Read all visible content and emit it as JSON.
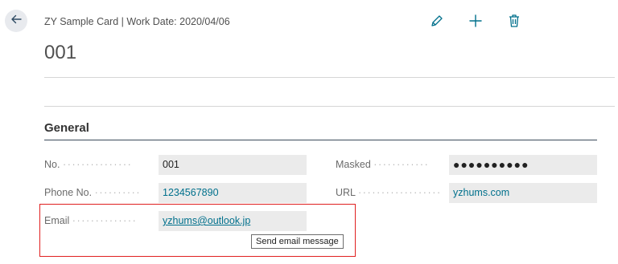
{
  "header": {
    "breadcrumb": "ZY Sample Card | Work Date: 2020/04/06",
    "record_title": "001"
  },
  "icons": {
    "back": "arrow-left-icon",
    "edit": "pencil-icon",
    "new": "plus-icon",
    "delete": "trash-icon"
  },
  "section": {
    "title": "General"
  },
  "fields": {
    "no": {
      "label": "No.",
      "value": "001"
    },
    "phone": {
      "label": "Phone No.",
      "value": "1234567890"
    },
    "email": {
      "label": "Email",
      "value": "yzhums@outlook.jp"
    },
    "masked": {
      "label": "Masked",
      "value": "●●●●●●●●●●"
    },
    "url": {
      "label": "URL",
      "value": "yzhums.com"
    }
  },
  "tooltip": {
    "text": "Send email message"
  },
  "colors": {
    "accent": "#00708c",
    "field_bg": "#ebebeb",
    "highlight": "#e02020"
  }
}
